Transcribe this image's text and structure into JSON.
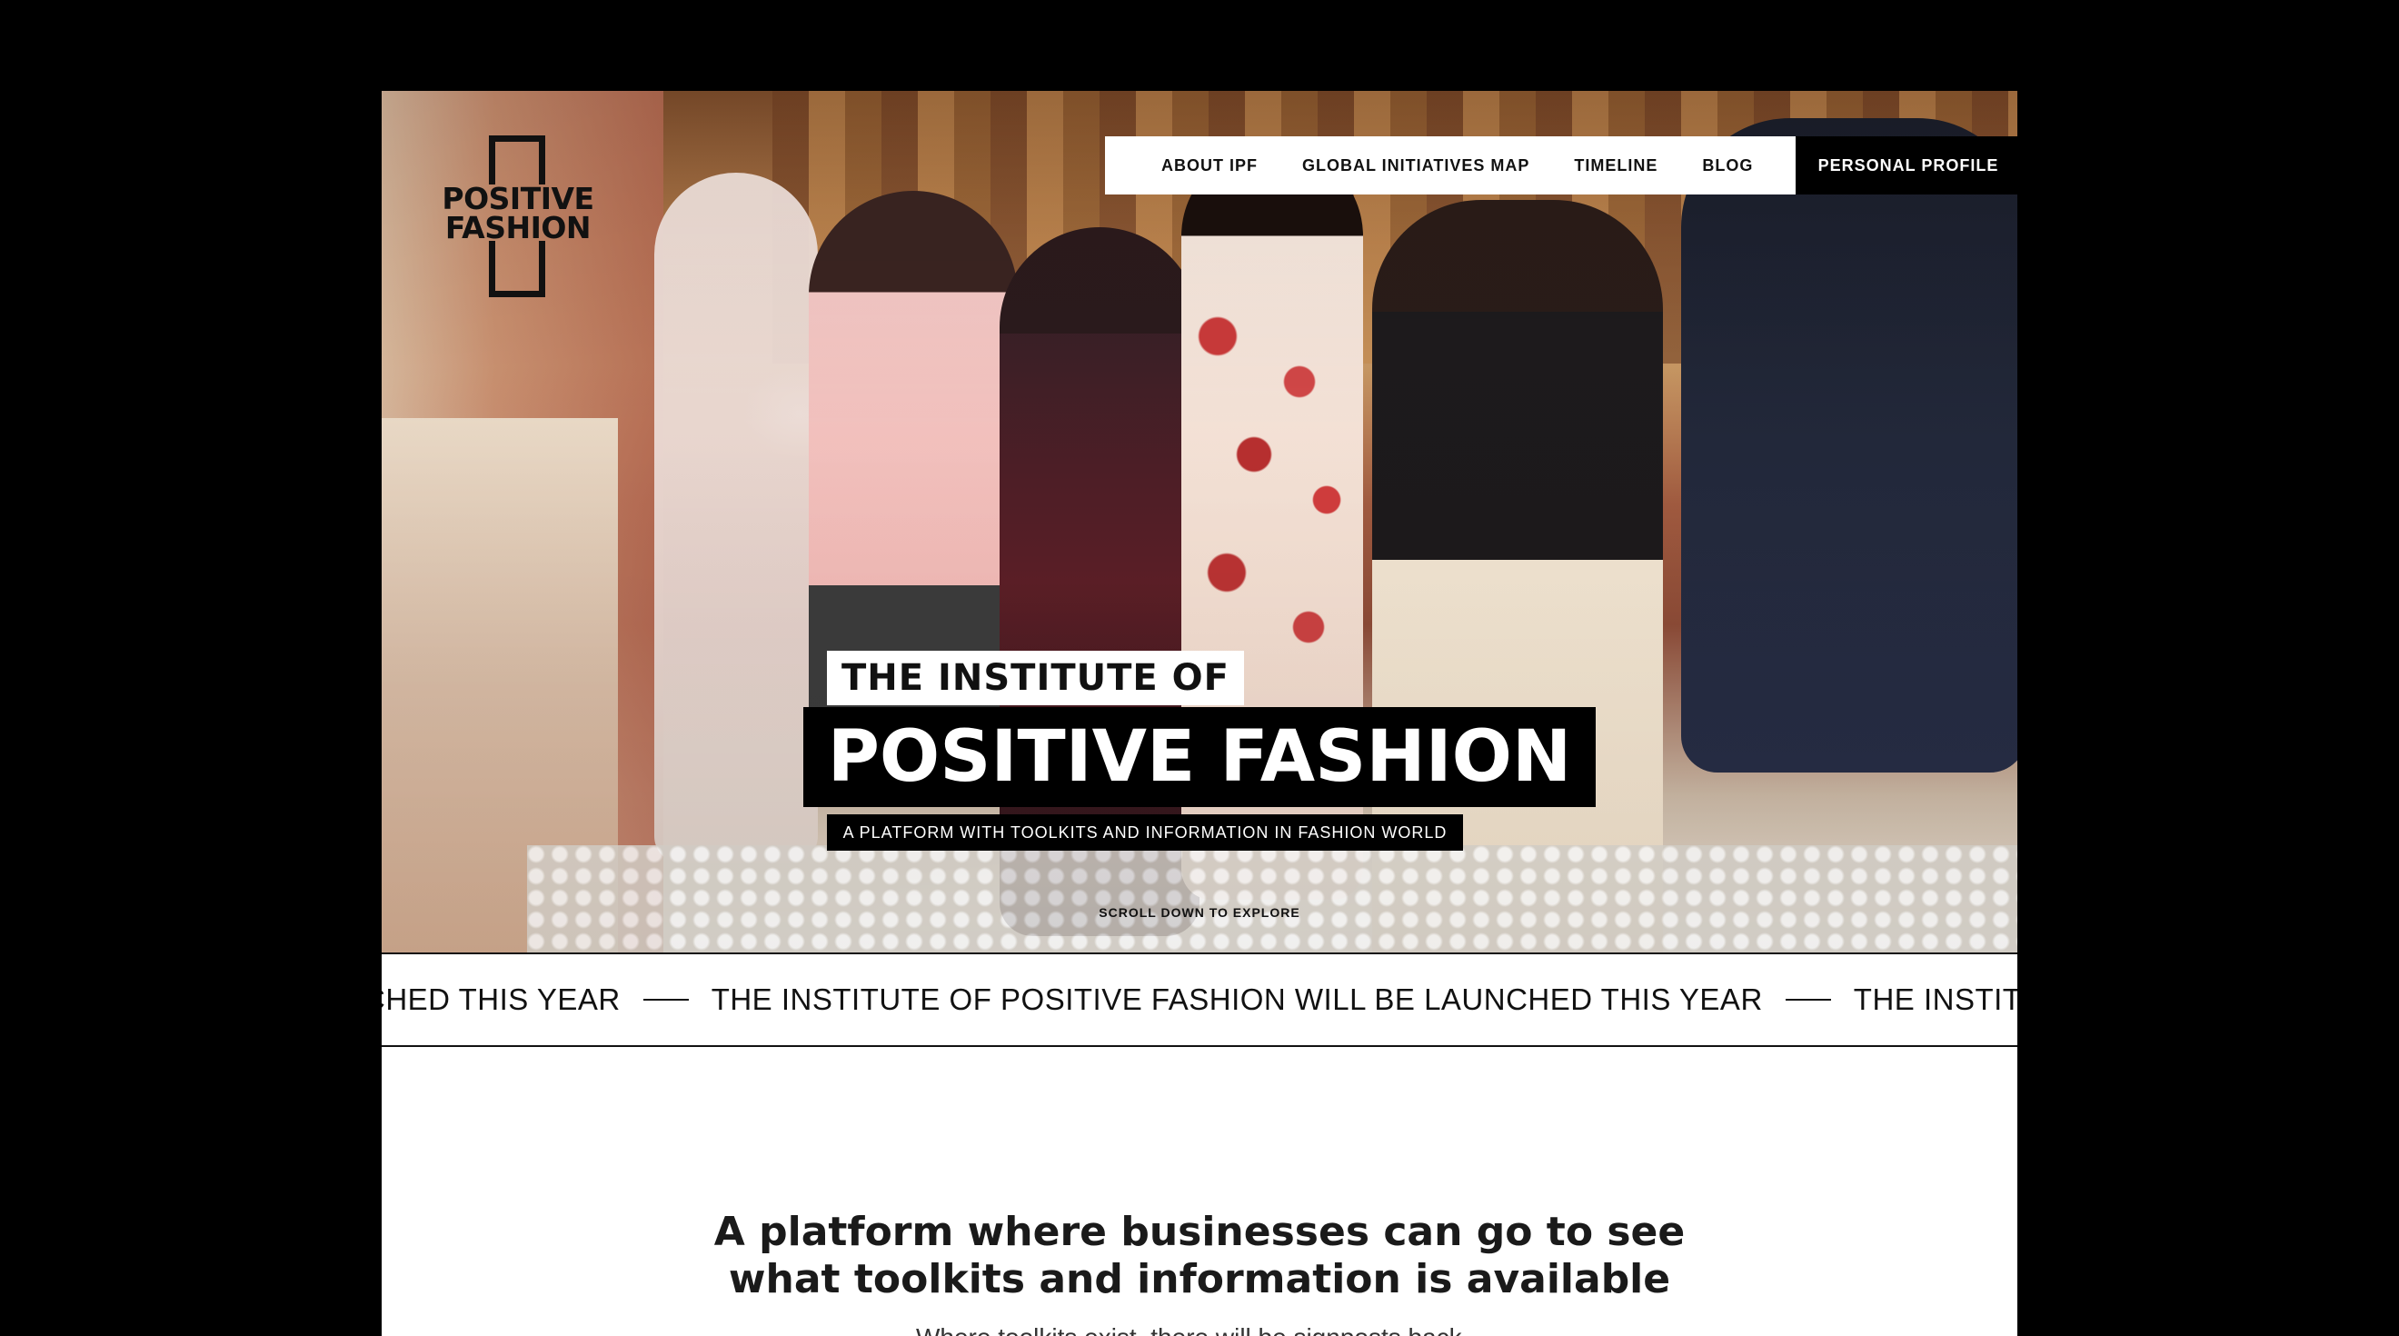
{
  "brand": {
    "logo_line1": "POSITIVE",
    "logo_line2": "FASHION"
  },
  "nav": {
    "items": [
      {
        "label": "ABOUT IPF"
      },
      {
        "label": "GLOBAL INITIATIVES MAP"
      },
      {
        "label": "TIMELINE"
      },
      {
        "label": "BLOG"
      }
    ],
    "profile_label": "PERSONAL PROFILE"
  },
  "hero": {
    "title_small": "THE INSTITUTE OF",
    "title_big": "POSITIVE FASHION",
    "subtitle": "A PLATFORM WITH TOOLKITS AND INFORMATION IN FASHION WORLD",
    "scroll_hint": "SCROLL DOWN TO EXPLORE"
  },
  "ticker": {
    "segments": [
      "CHED THIS YEAR",
      "THE INSTITUTE OF POSITIVE FASHION WILL BE LAUNCHED THIS YEAR",
      "THE INSTITUTE OF"
    ]
  },
  "content": {
    "heading_line1": "A platform where businesses can go to see",
    "heading_line2": "what toolkits and information is available",
    "body_partial": "Where toolkits exist, there will be signposts back..."
  }
}
